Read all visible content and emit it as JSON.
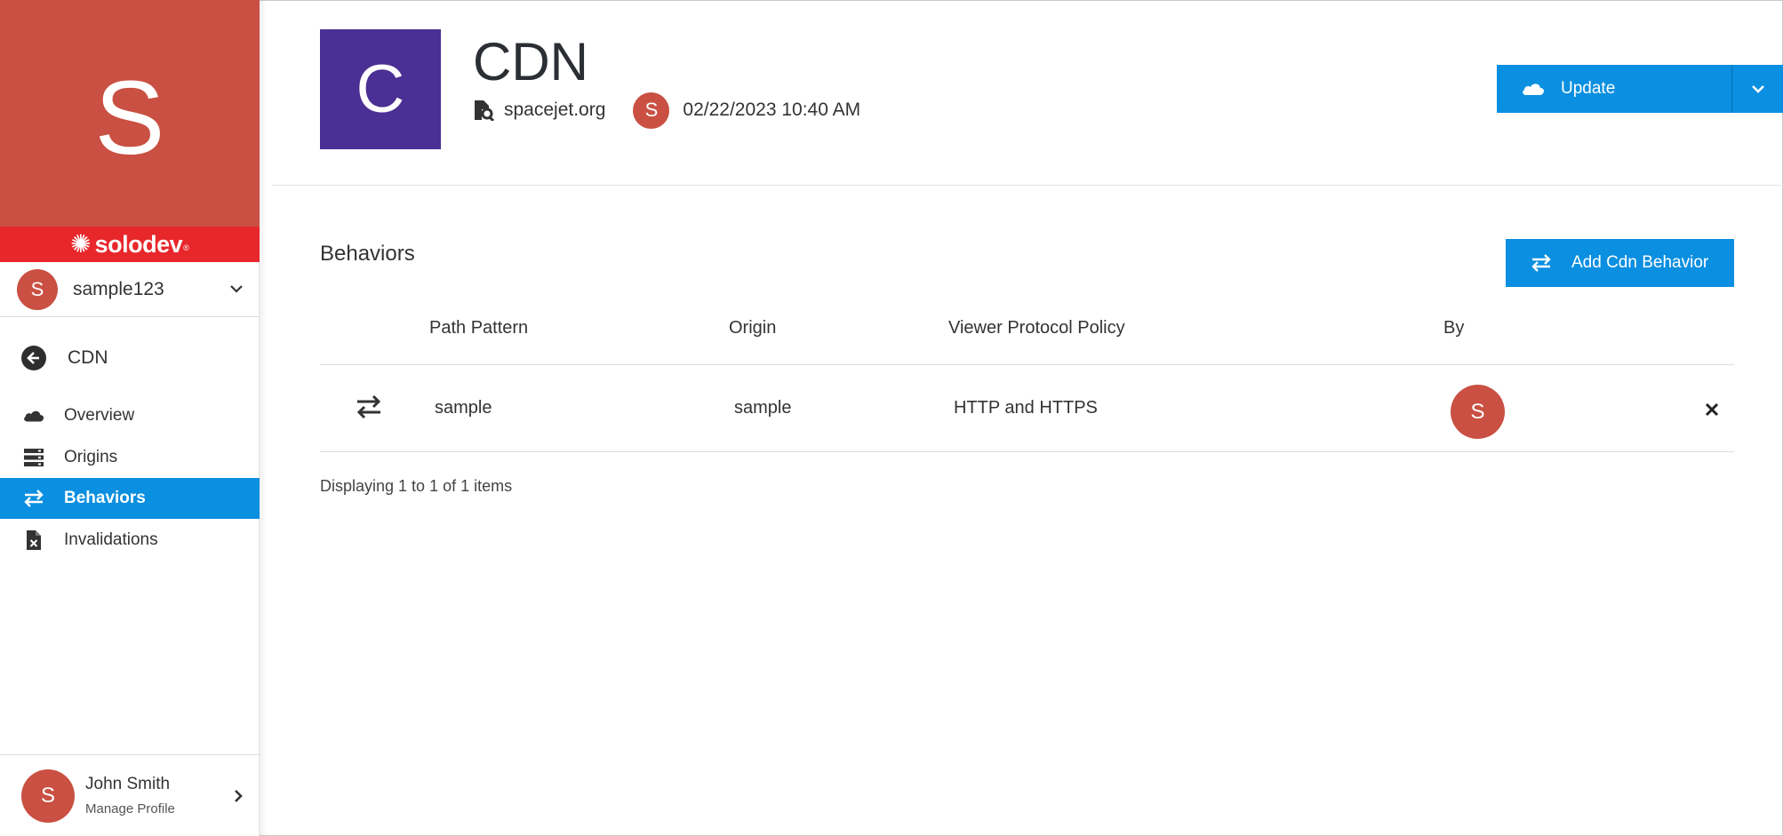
{
  "sidebar": {
    "brand_letter": "S",
    "brand_logo": "solodev",
    "brand_reg": "®",
    "account": {
      "avatar": "S",
      "name": "sample123"
    },
    "back": {
      "label": "CDN"
    },
    "items": [
      {
        "label": "Overview",
        "icon": "cloud-icon",
        "active": false
      },
      {
        "label": "Origins",
        "icon": "server-icon",
        "active": false
      },
      {
        "label": "Behaviors",
        "icon": "exchange-icon",
        "active": true
      },
      {
        "label": "Invalidations",
        "icon": "file-x-icon",
        "active": false
      }
    ],
    "profile": {
      "avatar": "S",
      "name": "John Smith",
      "subtitle": "Manage Profile"
    }
  },
  "header": {
    "tile_letter": "C",
    "title": "CDN",
    "site": "spacejet.org",
    "user_avatar": "S",
    "date": "02/22/2023 10:40 AM",
    "update_label": "Update"
  },
  "behaviors": {
    "title": "Behaviors",
    "add_label": "Add Cdn Behavior",
    "columns": [
      "Path Pattern",
      "Origin",
      "Viewer Protocol Policy",
      "By"
    ],
    "rows": [
      {
        "path_pattern": "sample",
        "origin": "sample",
        "viewer_protocol_policy": "HTTP and HTTPS",
        "by": "S"
      }
    ],
    "pager": "Displaying 1 to 1 of 1 items"
  },
  "colors": {
    "brand_red": "#c95042",
    "brand_bar": "#e8272b",
    "accent_blue": "#0b8fe0",
    "tile_purple": "#4a2f94"
  }
}
